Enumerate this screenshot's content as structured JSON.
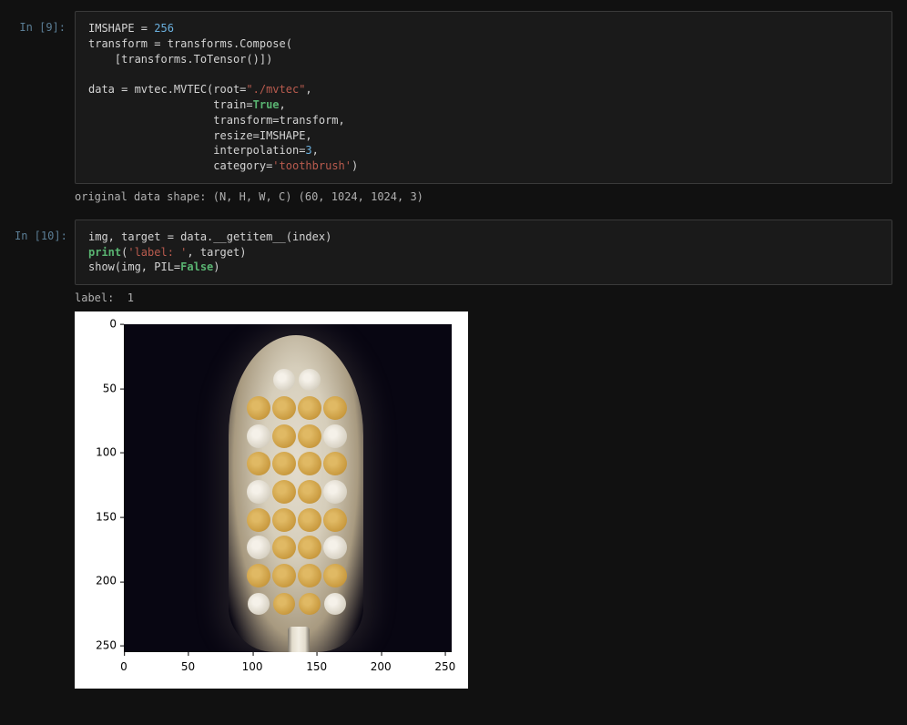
{
  "cells": {
    "c9": {
      "prompt": "In [9]:",
      "code": {
        "l0a": "IMSHAPE",
        "l0b": " = ",
        "l0c": "256",
        "l1a": "transform = transforms.Compose(",
        "l2a": "    [transforms.ToTensor",
        "l2b": "()])",
        "l4a": "data = mvtec.MVTEC(root=",
        "l4b": "\"./mvtec\"",
        "l4c": ",",
        "l5a": "                   train=",
        "l5b": "True",
        "l5c": ",",
        "l6a": "                   transform=transform,",
        "l7a": "                   resize=IMSHAPE,",
        "l8a": "                   interpolation=",
        "l8b": "3",
        "l8c": ",",
        "l9a": "                   category=",
        "l9b": "'toothbrush'",
        "l9c": ")"
      },
      "output": "original data shape: (N, H, W, C) (60, 1024, 1024, 3)"
    },
    "c10": {
      "prompt": "In [10]:",
      "code": {
        "l0a": "img, target = data.__getitem__(index)",
        "l1a": "print",
        "l1b": "(",
        "l1c": "'label: '",
        "l1d": ", target)",
        "l2a": "show(img, PIL=",
        "l2b": "False",
        "l2c": ")"
      },
      "output_label": "label:  1"
    }
  },
  "chart_data": {
    "type": "table",
    "description": "Matplotlib imshow of a 256x256 RGB image (toothbrush head on dark background)",
    "xlim": [
      0,
      256
    ],
    "ylim": [
      256,
      0
    ],
    "yticks": [
      0,
      50,
      100,
      150,
      200,
      250
    ],
    "xticks": [
      0,
      50,
      100,
      150,
      200,
      250
    ]
  },
  "ticks": {
    "y0": "0",
    "y1": "50",
    "y2": "100",
    "y3": "150",
    "y4": "200",
    "y5": "250",
    "x0": "0",
    "x1": "50",
    "x2": "100",
    "x3": "150",
    "x4": "200",
    "x5": "250"
  }
}
